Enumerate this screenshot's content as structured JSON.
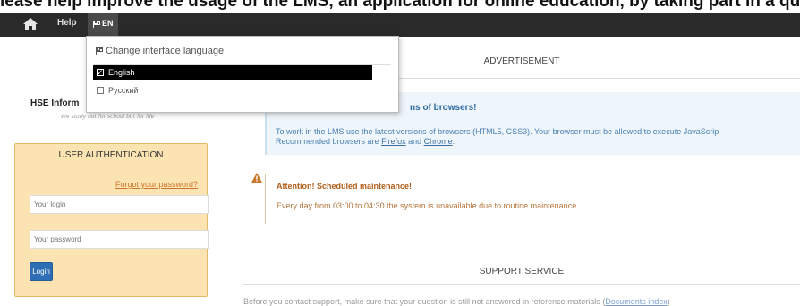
{
  "banner": {
    "text": "lease help improve the usage of the LMS, an application for online education, by taking part in a quick survey using"
  },
  "topbar": {
    "home_icon": "home-icon",
    "help_label": "Help",
    "language_label": "EN"
  },
  "language_menu": {
    "heading": "Change interface language",
    "options": [
      {
        "label": "English",
        "selected": true
      },
      {
        "label": "Русский",
        "selected": false
      }
    ]
  },
  "sidebar": {
    "site_title": "HSE Inform",
    "motto": "We study not for school but for life",
    "auth": {
      "title": "USER AUTHENTICATION",
      "forgot_link": "Forgot your password?",
      "login_placeholder": "Your login",
      "password_placeholder": "Your password",
      "login_button": "Login"
    }
  },
  "main": {
    "advertisement_heading": "ADVERTISEMENT",
    "browsers_notice": {
      "title": "ns of browsers!",
      "text_line1": "To work in the LMS use the latest versions of browsers (HTML5, CSS3). Your browser must be allowed to execute JavaScrip",
      "text_line2_prefix": "Recommended browsers are ",
      "link_firefox": "Firefox",
      "text_and": " and ",
      "link_chrome": "Chrome",
      "text_end": "."
    },
    "maintenance_notice": {
      "title": "Attention! Scheduled maintenance!",
      "text": "Every day from 03:00 to 04:30 the system is unavailable due to routine maintenance."
    },
    "support_heading": "SUPPORT SERVICE",
    "support_text_prefix": "Before you contact support, make sure that your question is still not answered in reference materials (",
    "support_link": "Documents index",
    "support_text_suffix": ")"
  },
  "colors": {
    "topbar_bg": "#2a2a2a",
    "auth_panel_bg": "#fbe4b2",
    "login_button_bg": "#2f6eb5",
    "info_title": "#2d6aa6",
    "warning_title": "#b25d17"
  }
}
